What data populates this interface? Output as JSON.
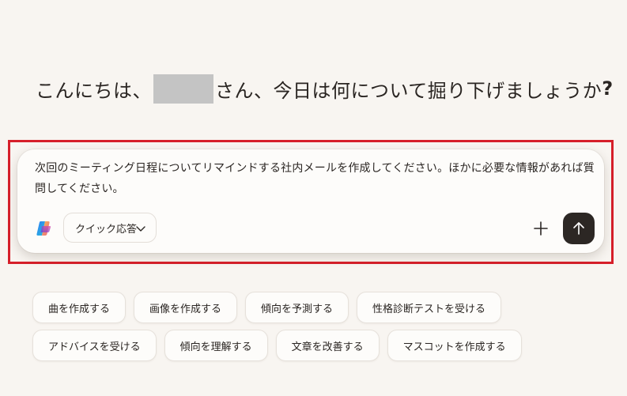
{
  "greeting": {
    "prefix": "こんにちは、",
    "suffix": "さん、今日は何について掘り下げましょうか",
    "mark": "?"
  },
  "composer": {
    "text": "次回のミーティング日程についてリマインドする社内メールを作成してください。ほかに必要な情報があれば質問してください。",
    "mode_label": "クイック応答",
    "logo_icon": "copilot-logo",
    "plus_icon": "plus-icon",
    "send_icon": "arrow-up-icon"
  },
  "suggestions": {
    "row1": [
      "曲を作成する",
      "画像を作成する",
      "傾向を予測する",
      "性格診断テストを受ける"
    ],
    "row2": [
      "アドバイスを受ける",
      "傾向を理解する",
      "文章を改善する",
      "マスコットを作成する"
    ]
  },
  "colors": {
    "background": "#f8f5f1",
    "highlight_border": "#d61f2a",
    "send_button": "#2c2724",
    "redaction": "#c4c4c4"
  }
}
